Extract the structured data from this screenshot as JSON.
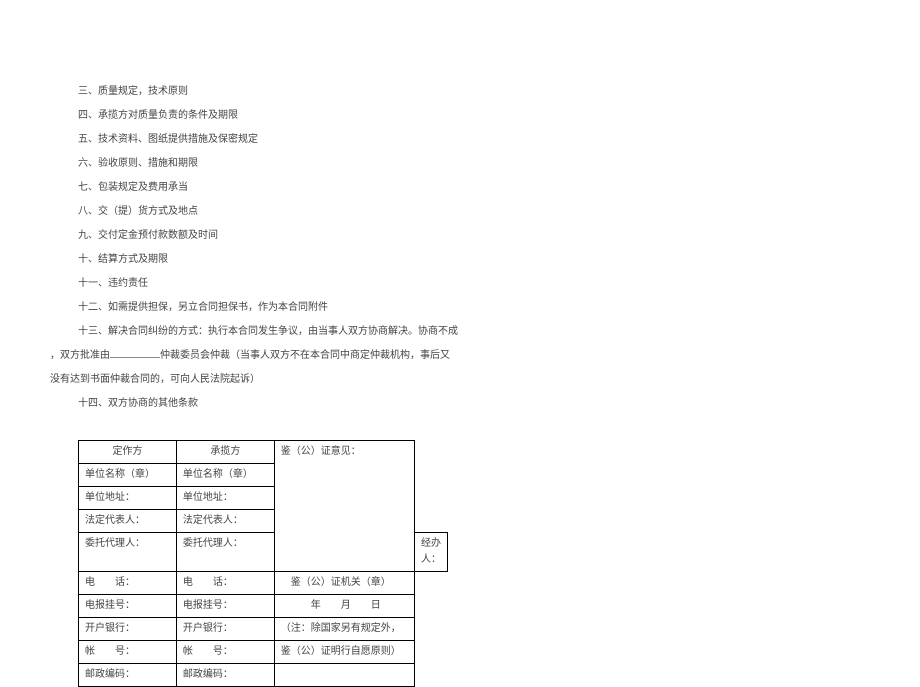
{
  "clauses": {
    "c3": "三、质量规定，技术原则",
    "c4": "四、承揽方对质量负责的条件及期限",
    "c5": "五、技术资料、图纸提供措施及保密规定",
    "c6": "六、验收原则、措施和期限",
    "c7": "七、包装规定及费用承当",
    "c8": "八、交（提）货方式及地点",
    "c9": "九、交付定金预付款数额及时间",
    "c10": "十、结算方式及期限",
    "c11": "十一、违约责任",
    "c12": "十二、如需提供担保，另立合同担保书，作为本合同附件",
    "c13a": "十三、解决合同纠纷的方式：执行本合同发生争议，由当事人双方协商解决。协商不成",
    "c13b_pre": "，双方批准由",
    "c13b_post": "仲裁委员会仲裁（当事人双方不在本合同中商定仲裁机构，事后又",
    "c13c": "没有达到书面仲裁合同的，可向人民法院起诉）",
    "c14": "十四、双方协商的其他条款"
  },
  "table": {
    "headers": {
      "h1": "定作方",
      "h2": "承揽方",
      "h3": "鉴（公）证意见："
    },
    "rows": {
      "unit_name": "单位名称（章）",
      "unit_addr": "单位地址：",
      "legal_rep": "法定代表人：",
      "agent": "委托代理人：",
      "phone": "电　　话：",
      "telegram": "电报挂号：",
      "bank": "开户银行：",
      "account": "帐　　号：",
      "postal": "邮政编码："
    },
    "col3": {
      "handler": "经办人：",
      "cert_org": "　鉴（公）证机关（章）",
      "date": "　　　年　　月　　日",
      "note1": "（注：除国家另有规定外，",
      "note2": "鉴（公）证明行自愿原则）"
    }
  }
}
